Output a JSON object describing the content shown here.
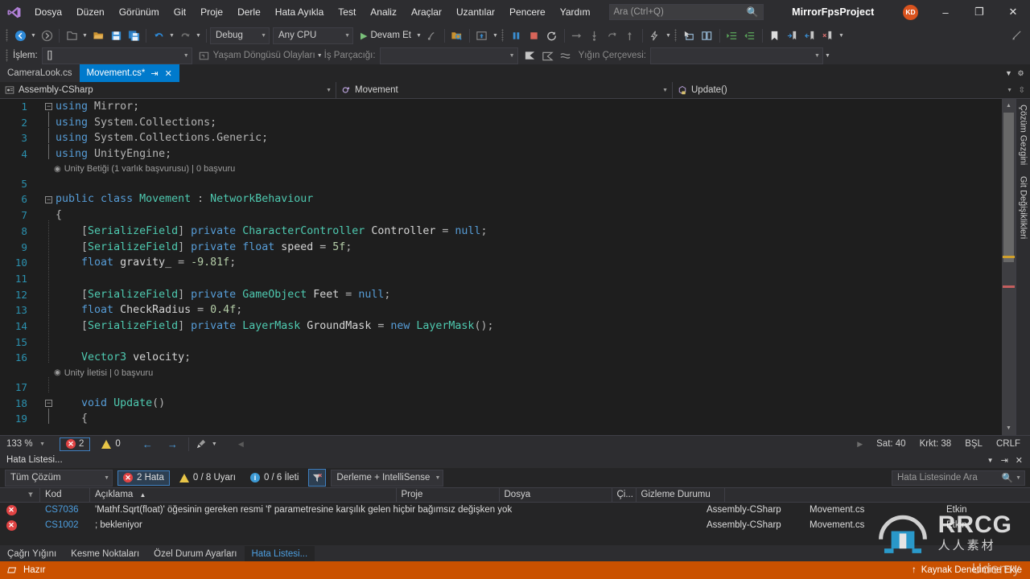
{
  "titlebar": {
    "logo_icon": "visual-studio-logo",
    "menu": [
      "Dosya",
      "Düzen",
      "Görünüm",
      "Git",
      "Proje",
      "Derle",
      "Hata Ayıkla",
      "Test",
      "Analiz",
      "Araçlar",
      "Uzantılar",
      "Pencere",
      "Yardım"
    ],
    "search_placeholder": "Ara (Ctrl+Q)",
    "search_icon": "search-icon",
    "project_title": "MirrorFpsProject",
    "avatar_initials": "KD",
    "avatar_color": "#d9531e",
    "minimize": "–",
    "restore": "❐",
    "close": "✕"
  },
  "toolbar": {
    "nav_back": "◀",
    "nav_forward": "▶",
    "debug_config": "Debug",
    "platform": "Any CPU",
    "run_label": "Devam Et",
    "icons": [
      "new-project-icon",
      "open-folder-icon",
      "save-icon",
      "save-all-icon",
      "undo-icon",
      "redo-icon",
      "live-share-icon",
      "open-file-icon",
      "preview-icon",
      "pause-icon",
      "stop-icon",
      "restart-icon",
      "step-over-icon",
      "step-into-icon",
      "step-out-icon",
      "hot-reload-icon",
      "select-element-icon",
      "layout-icon",
      "indent-icon",
      "outdent-icon",
      "bookmark-icon",
      "comment-icon",
      "uncomment-icon",
      "expand-icon"
    ]
  },
  "debug_toolbar": {
    "process_label": "İşlem:",
    "process_value": "[]",
    "lifecycle_label": "Yaşam Döngüsü Olayları",
    "thread_label": "İş Parçacığı:",
    "thread_value": "",
    "stackframe_label": "Yığın Çerçevesi:",
    "stackframe_value": ""
  },
  "tabs": [
    {
      "label": "CameraLook.cs",
      "active": false
    },
    {
      "label": "Movement.cs*",
      "active": true,
      "pin_icon": "pin-icon",
      "close_icon": "close-icon"
    }
  ],
  "navbar": {
    "project": "Assembly-CSharp",
    "type": "Movement",
    "member": "Update()",
    "project_icon": "project-icon",
    "class-icon": "class-icon",
    "method_icon": "method-icon"
  },
  "editor": {
    "lines": [
      {
        "n": "1",
        "fold": "minus",
        "indent": 0,
        "change": "none",
        "tokens": [
          {
            "t": "using ",
            "c": "k"
          },
          {
            "t": "Mirror;",
            "c": "n"
          }
        ]
      },
      {
        "n": "2",
        "fold": "bar",
        "indent": 0,
        "change": "none",
        "tokens": [
          {
            "t": "using ",
            "c": "k"
          },
          {
            "t": "System.Collections;",
            "c": "n"
          }
        ]
      },
      {
        "n": "3",
        "fold": "bar",
        "indent": 0,
        "change": "none",
        "tokens": [
          {
            "t": "using ",
            "c": "k"
          },
          {
            "t": "System.Collections.Generic;",
            "c": "n"
          }
        ]
      },
      {
        "n": "4",
        "fold": "barend",
        "indent": 0,
        "change": "none",
        "tokens": [
          {
            "t": "using ",
            "c": "k"
          },
          {
            "t": "UnityEngine;",
            "c": "n"
          }
        ]
      },
      {
        "n": "5",
        "fold": "",
        "indent": 0,
        "change": "none",
        "tokens": []
      },
      {
        "n": "6",
        "fold": "minus",
        "indent": 0,
        "change": "none",
        "tokens": [
          {
            "t": "public ",
            "c": "k"
          },
          {
            "t": "class ",
            "c": "k"
          },
          {
            "t": "Movement",
            "c": "t"
          },
          {
            "t": " : ",
            "c": "n"
          },
          {
            "t": "NetworkBehaviour",
            "c": "t"
          }
        ]
      },
      {
        "n": "7",
        "fold": "",
        "indent": 0,
        "change": "none",
        "tokens": [
          {
            "t": "{",
            "c": "n"
          }
        ]
      },
      {
        "n": "8",
        "fold": "dot",
        "indent": 1,
        "change": "none",
        "tokens": [
          {
            "t": "[",
            "c": "n"
          },
          {
            "t": "SerializeField",
            "c": "a"
          },
          {
            "t": "] ",
            "c": "n"
          },
          {
            "t": "private ",
            "c": "k"
          },
          {
            "t": "CharacterController",
            "c": "t"
          },
          {
            "t": " ",
            "c": "n"
          },
          {
            "t": "Controller",
            "c": "id"
          },
          {
            "t": " = ",
            "c": "n"
          },
          {
            "t": "null",
            "c": "k"
          },
          {
            "t": ";",
            "c": "n"
          }
        ]
      },
      {
        "n": "9",
        "fold": "dot",
        "indent": 1,
        "change": "green",
        "tokens": [
          {
            "t": "[",
            "c": "n"
          },
          {
            "t": "SerializeField",
            "c": "a"
          },
          {
            "t": "] ",
            "c": "n"
          },
          {
            "t": "private ",
            "c": "k"
          },
          {
            "t": "float ",
            "c": "k"
          },
          {
            "t": "speed",
            "c": "id"
          },
          {
            "t": " = ",
            "c": "n"
          },
          {
            "t": "5f",
            "c": "num"
          },
          {
            "t": ";",
            "c": "n"
          }
        ]
      },
      {
        "n": "10",
        "fold": "dot",
        "indent": 1,
        "change": "yellow",
        "tokens": [
          {
            "t": "float ",
            "c": "k"
          },
          {
            "t": "gravity_",
            "c": "id"
          },
          {
            "t": " = ",
            "c": "n"
          },
          {
            "t": "-9.81f",
            "c": "num"
          },
          {
            "t": ";",
            "c": "n"
          }
        ]
      },
      {
        "n": "11",
        "fold": "dot",
        "indent": 1,
        "change": "none",
        "tokens": []
      },
      {
        "n": "12",
        "fold": "dot",
        "indent": 1,
        "change": "yellow",
        "tokens": [
          {
            "t": "[",
            "c": "n"
          },
          {
            "t": "SerializeField",
            "c": "a"
          },
          {
            "t": "] ",
            "c": "n"
          },
          {
            "t": "private ",
            "c": "k"
          },
          {
            "t": "GameObject",
            "c": "t"
          },
          {
            "t": " ",
            "c": "n"
          },
          {
            "t": "Feet",
            "c": "id"
          },
          {
            "t": " = ",
            "c": "n"
          },
          {
            "t": "null",
            "c": "k"
          },
          {
            "t": ";",
            "c": "n"
          }
        ]
      },
      {
        "n": "13",
        "fold": "dot",
        "indent": 1,
        "change": "yellow",
        "tokens": [
          {
            "t": "float ",
            "c": "k"
          },
          {
            "t": "CheckRadius",
            "c": "id"
          },
          {
            "t": " = ",
            "c": "n"
          },
          {
            "t": "0.4f",
            "c": "num"
          },
          {
            "t": ";",
            "c": "n"
          }
        ]
      },
      {
        "n": "14",
        "fold": "dot",
        "indent": 1,
        "change": "green",
        "tokens": [
          {
            "t": "[",
            "c": "n"
          },
          {
            "t": "SerializeField",
            "c": "a"
          },
          {
            "t": "] ",
            "c": "n"
          },
          {
            "t": "private ",
            "c": "k"
          },
          {
            "t": "LayerMask",
            "c": "t"
          },
          {
            "t": " ",
            "c": "n"
          },
          {
            "t": "GroundMask",
            "c": "id"
          },
          {
            "t": " = ",
            "c": "n"
          },
          {
            "t": "new ",
            "c": "k"
          },
          {
            "t": "LayerMask",
            "c": "t"
          },
          {
            "t": "();",
            "c": "n"
          }
        ]
      },
      {
        "n": "15",
        "fold": "dot",
        "indent": 1,
        "change": "green",
        "tokens": []
      },
      {
        "n": "16",
        "fold": "dot",
        "indent": 1,
        "change": "green",
        "tokens": [
          {
            "t": "Vector3",
            "c": "t"
          },
          {
            "t": " ",
            "c": "n"
          },
          {
            "t": "velocity",
            "c": "id"
          },
          {
            "t": ";",
            "c": "n"
          }
        ]
      },
      {
        "n": "17",
        "fold": "dot",
        "indent": 1,
        "change": "none",
        "tokens": []
      },
      {
        "n": "18",
        "fold": "minus",
        "indent": 1,
        "change": "none",
        "tokens": [
          {
            "t": "void ",
            "c": "k"
          },
          {
            "t": "Update",
            "c": "t"
          },
          {
            "t": "()",
            "c": "n"
          }
        ]
      },
      {
        "n": "19",
        "fold": "bar",
        "indent": 1,
        "change": "none",
        "tokens": [
          {
            "t": "{",
            "c": "n"
          }
        ]
      }
    ],
    "codelens": [
      {
        "after_line": "5",
        "icon": "unity-icon",
        "text": "Unity Betiği (1 varlık başvurusu) | 0 başvuru"
      },
      {
        "after_line": "17",
        "icon": "unity-icon",
        "text": "Unity İletisi | 0 başvuru"
      }
    ],
    "right_rail": [
      "Çözüm Gezgini",
      "Git Değişiklikleri"
    ]
  },
  "editor_status": {
    "zoom": "133 %",
    "error_count": "2",
    "warning_count": "0",
    "error_icon": "error-icon",
    "warning_icon": "warning-icon",
    "prev_icon": "arrow-left-icon",
    "next_icon": "arrow-right-icon",
    "brush_icon": "brush-icon",
    "line": "Sat: 40",
    "col": "Krkt: 38",
    "ins": "BŞL",
    "eol": "CRLF"
  },
  "error_panel": {
    "title": "Hata Listesi...",
    "scope": "Tüm Çözüm",
    "errors_chip": "2 Hata",
    "warnings_chip": "0 / 8 Uyarı",
    "messages_chip": "0 / 6 İleti",
    "build_filter": "Derleme + IntelliSense",
    "search_placeholder": "Hata Listesinde Ara",
    "columns": [
      "Kod",
      "Açıklama",
      "Proje",
      "Dosya",
      "Çi...",
      "Gizleme Durumu"
    ],
    "sort_indicator": "▲",
    "rows": [
      {
        "severity": "error",
        "code": "CS7036",
        "description": "'Mathf.Sqrt(float)' öğesinin gereken resmi 'f' parametresine karşılık gelen hiçbir bağımsız değişken yok",
        "project": "Assembly-CSharp",
        "file": "Movement.cs",
        "line": "",
        "suppression": "Etkin"
      },
      {
        "severity": "error",
        "code": "CS1002",
        "description": "; bekleniyor",
        "project": "Assembly-CSharp",
        "file": "Movement.cs",
        "line": "",
        "suppression": "Etkin"
      }
    ],
    "tabs": [
      {
        "label": "Çağrı Yığını",
        "active": false
      },
      {
        "label": "Kesme Noktaları",
        "active": false
      },
      {
        "label": "Özel Durum Ayarları",
        "active": false
      },
      {
        "label": "Hata Listesi...",
        "active": true
      }
    ]
  },
  "statusbar": {
    "state": "Hazır",
    "state_icon": "ready-icon",
    "source_control": "Kaynak Denetimine Ekle",
    "source_control_icon": "arrow-up-icon",
    "color": "#ca5100"
  },
  "watermark": {
    "brand": "RRCG",
    "brand_cn": "人人素材",
    "course": "Udemy"
  }
}
